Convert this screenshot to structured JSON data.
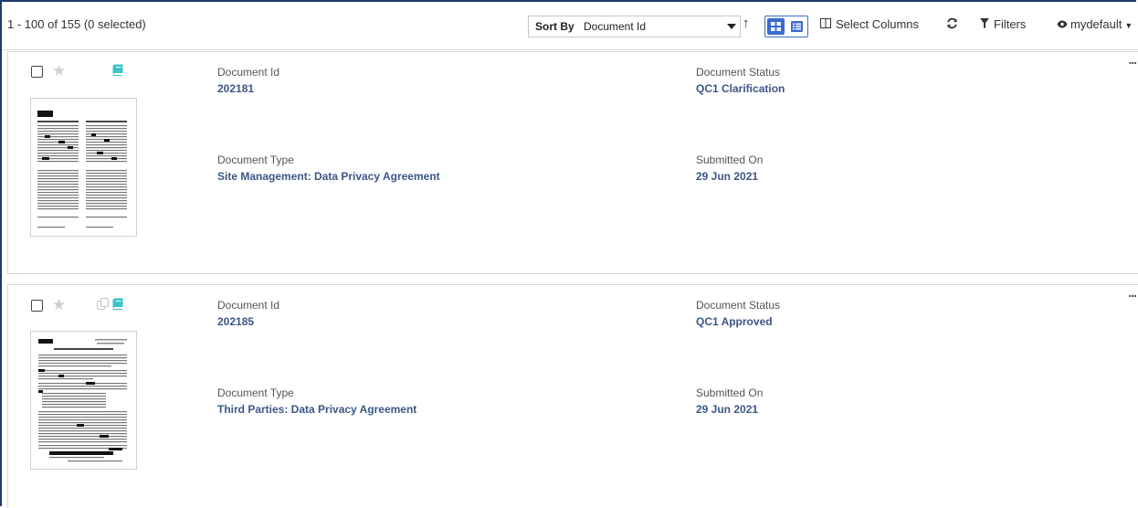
{
  "toolbar": {
    "count_text": "1 - 100 of 155 (0 selected)",
    "sort_label": "Sort By",
    "sort_value": "Document Id",
    "sort_direction_icon": "arrow-up-icon",
    "select_columns_label": "Select Columns",
    "refresh_icon": "refresh-icon",
    "filters_label": "Filters",
    "view_label": "mydefault"
  },
  "cards": [
    {
      "document_id_label": "Document Id",
      "document_id": "202181",
      "document_status_label": "Document Status",
      "document_status": "QC1 Clarification",
      "document_type_label": "Document Type",
      "document_type": "Site Management: Data Privacy Agreement",
      "submitted_on_label": "Submitted On",
      "submitted_on": "29 Jun 2021",
      "more": "...",
      "icons": [
        "checkbox",
        "star-icon",
        "book-icon"
      ]
    },
    {
      "document_id_label": "Document Id",
      "document_id": "202185",
      "document_status_label": "Document Status",
      "document_status": "QC1 Approved",
      "document_type_label": "Document Type",
      "document_type": "Third Parties: Data Privacy Agreement",
      "submitted_on_label": "Submitted On",
      "submitted_on": "29 Jun 2021",
      "more": "...",
      "icons": [
        "checkbox",
        "star-icon",
        "copy-icon",
        "book-icon"
      ]
    }
  ],
  "colors": {
    "accent": "#3e6bd0",
    "value_text": "#3b5686",
    "book_icon": "#3cc6c6",
    "frame": "#1f3a6e"
  }
}
